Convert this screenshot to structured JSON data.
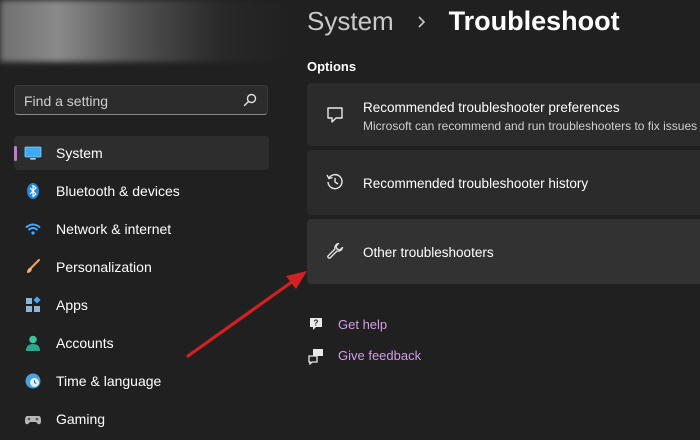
{
  "sidebar": {
    "search_placeholder": "Find a setting",
    "items": [
      {
        "label": "System",
        "icon": "monitor-icon",
        "active": true
      },
      {
        "label": "Bluetooth & devices",
        "icon": "bluetooth-icon"
      },
      {
        "label": "Network & internet",
        "icon": "wifi-icon"
      },
      {
        "label": "Personalization",
        "icon": "brush-icon"
      },
      {
        "label": "Apps",
        "icon": "apps-icon"
      },
      {
        "label": "Accounts",
        "icon": "person-icon"
      },
      {
        "label": "Time & language",
        "icon": "globe-clock-icon"
      },
      {
        "label": "Gaming",
        "icon": "gamepad-icon"
      }
    ]
  },
  "header": {
    "parent": "System",
    "title": "Troubleshoot"
  },
  "main": {
    "section_label": "Options",
    "cards": [
      {
        "title": "Recommended troubleshooter preferences",
        "subtitle": "Microsoft can recommend and run troubleshooters to fix issues",
        "icon": "chat-bubble-icon"
      },
      {
        "title": "Recommended troubleshooter history",
        "icon": "history-icon"
      },
      {
        "title": "Other troubleshooters",
        "icon": "wrench-icon"
      }
    ],
    "links": [
      {
        "label": "Get help",
        "icon": "help-icon"
      },
      {
        "label": "Give feedback",
        "icon": "feedback-icon"
      }
    ]
  },
  "colors": {
    "accent": "#c478d6",
    "link": "#d59bea",
    "annotation_arrow": "#d32020"
  }
}
